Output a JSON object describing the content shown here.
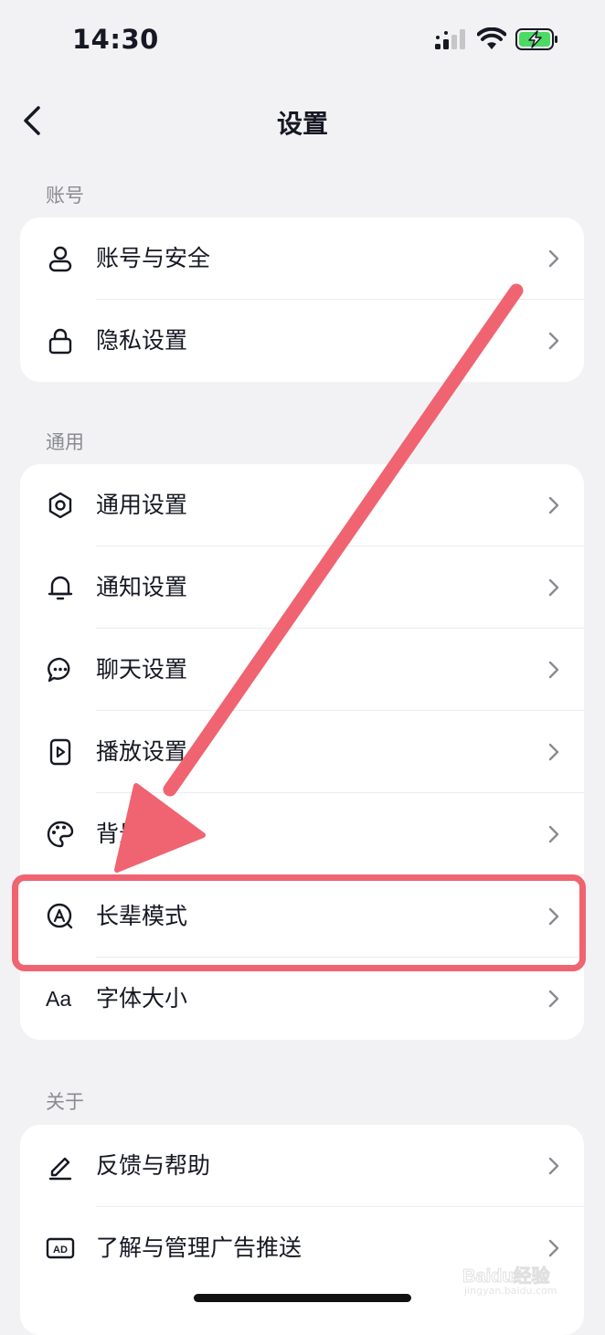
{
  "status_bar": {
    "time": "14:30"
  },
  "header": {
    "title": "设置"
  },
  "sections": [
    {
      "label": "账号",
      "items": [
        {
          "label": "账号与安全",
          "icon": "user-icon"
        },
        {
          "label": "隐私设置",
          "icon": "lock-icon"
        }
      ]
    },
    {
      "label": "通用",
      "items": [
        {
          "label": "通用设置",
          "icon": "gear-icon"
        },
        {
          "label": "通知设置",
          "icon": "bell-icon"
        },
        {
          "label": "聊天设置",
          "icon": "chat-bubble-icon"
        },
        {
          "label": "播放设置",
          "icon": "play-icon"
        },
        {
          "label": "背景设置",
          "icon": "palette-icon"
        },
        {
          "label": "长辈模式",
          "icon": "elder-mode-icon"
        },
        {
          "label": "字体大小",
          "icon": "font-size-icon",
          "icon_text": "Aa"
        }
      ]
    },
    {
      "label": "关于",
      "items": [
        {
          "label": "反馈与帮助",
          "icon": "edit-pen-icon"
        },
        {
          "label": "了解与管理广告推送",
          "icon": "ad-icon",
          "icon_text": "AD"
        }
      ]
    }
  ],
  "annotation": {
    "highlight_color": "#ef6470",
    "target_item": "长辈模式"
  },
  "watermark": {
    "text": "Baidu经验",
    "sub": "jingyan.baidu.com"
  }
}
